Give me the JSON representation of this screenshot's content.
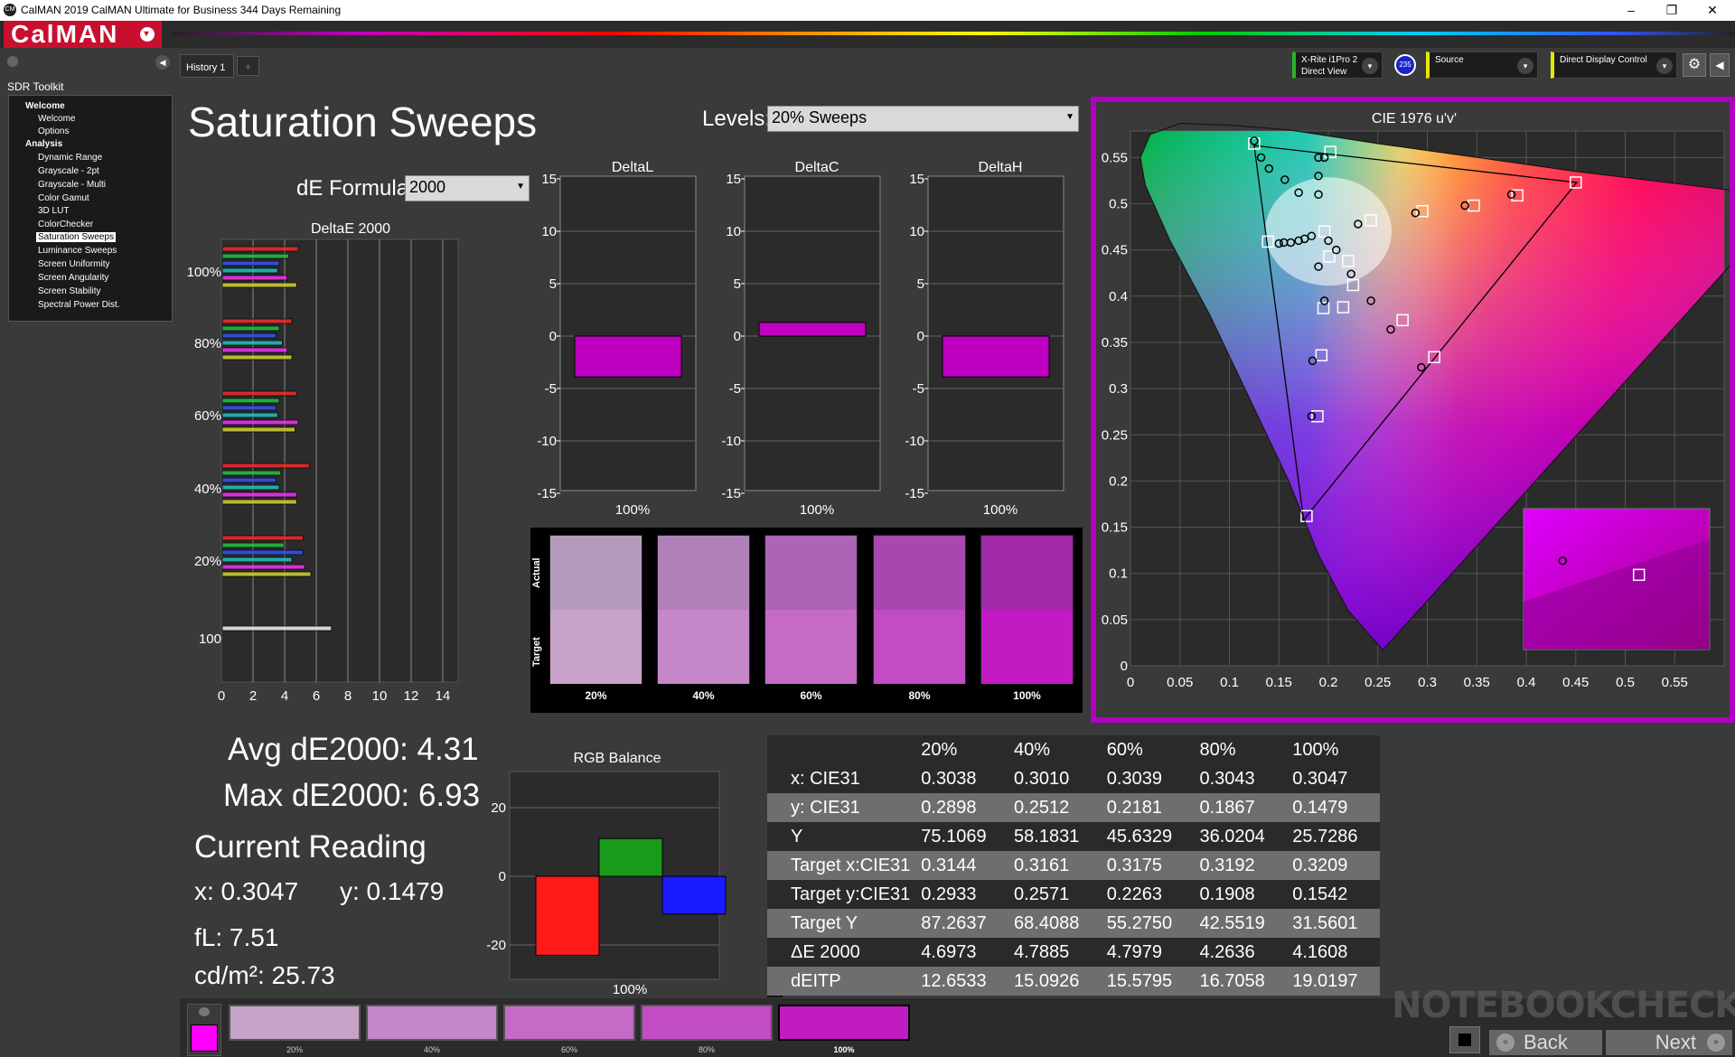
{
  "window": {
    "title": "CalMAN 2019 CalMAN Ultimate for Business 344 Days Remaining",
    "icon": "CM",
    "minimize": "–",
    "maximize": "❐",
    "close": "✕"
  },
  "logo": {
    "text": "CalMAN",
    "menu": "▾"
  },
  "sidebar": {
    "title": "SDR Toolkit",
    "items": [
      {
        "label": "Welcome"
      },
      {
        "label": "Welcome"
      },
      {
        "label": "Options"
      },
      {
        "label": "Analysis"
      },
      {
        "label": "Dynamic Range"
      },
      {
        "label": "Grayscale - 2pt"
      },
      {
        "label": "Grayscale - Multi"
      },
      {
        "label": "Color Gamut"
      },
      {
        "label": "3D LUT"
      },
      {
        "label": "ColorChecker"
      },
      {
        "label": "Saturation Sweeps"
      },
      {
        "label": "Luminance Sweeps"
      },
      {
        "label": "Screen Uniformity"
      },
      {
        "label": "Screen Angularity"
      },
      {
        "label": "Screen Stability"
      },
      {
        "label": "Spectral Power Dist."
      }
    ]
  },
  "tabs": {
    "history": "History 1",
    "add": "+"
  },
  "devices": {
    "meter": {
      "line1": "X-Rite i1Pro 2",
      "line2": "Direct View",
      "color": "#2bb02b",
      "badge": "235"
    },
    "source": {
      "label": "Source",
      "color": "#e6e600"
    },
    "display": {
      "label": "Direct Display Control",
      "color": "#e6e600"
    }
  },
  "page": {
    "title": "Saturation Sweeps",
    "levels_label": "Levels:",
    "levels_value": "20% Sweeps",
    "de_label": "dE Formula:",
    "de_value": "2000"
  },
  "deltaE_chart": {
    "title": "DeltaE 2000",
    "x_ticks": [
      "0",
      "2",
      "4",
      "6",
      "8",
      "10",
      "12",
      "14"
    ],
    "groups": [
      {
        "label": "100%",
        "values": [
          4.8,
          4.2,
          3.6,
          3.5,
          4.1,
          4.7
        ]
      },
      {
        "label": "80%",
        "values": [
          4.4,
          3.6,
          3.4,
          3.8,
          4.1,
          4.4
        ]
      },
      {
        "label": "60%",
        "values": [
          4.7,
          3.6,
          3.4,
          3.5,
          4.8,
          4.6
        ]
      },
      {
        "label": "40%",
        "values": [
          5.5,
          3.7,
          3.4,
          3.6,
          4.7,
          4.7
        ]
      },
      {
        "label": "20%",
        "values": [
          5.1,
          3.9,
          5.1,
          4.4,
          5.2,
          5.6
        ]
      },
      {
        "label": "100",
        "values": [
          6.9
        ]
      }
    ],
    "colors": [
      "#ff2a2a",
      "#22cc44",
      "#3355ff",
      "#22cccc",
      "#ff33ff",
      "#dddd33"
    ]
  },
  "delta_charts": [
    {
      "title": "DeltaL",
      "value": -3.9,
      "xlabel": "100%"
    },
    {
      "title": "DeltaC",
      "value": 1.3,
      "xlabel": "100%"
    },
    {
      "title": "DeltaH",
      "value": -3.9,
      "xlabel": "100%"
    }
  ],
  "delta_y_ticks": [
    "15",
    "10",
    "5",
    "0",
    "-5",
    "-10",
    "-15"
  ],
  "swatches": {
    "actual_label": "Actual",
    "target_label": "Target",
    "items": [
      {
        "label": "20%",
        "actual": "#b49bbc",
        "target": "#c6a2c8"
      },
      {
        "label": "40%",
        "actual": "#b081b8",
        "target": "#c587c8"
      },
      {
        "label": "60%",
        "actual": "#ac64b4",
        "target": "#c56ac7"
      },
      {
        "label": "80%",
        "actual": "#a748ae",
        "target": "#c24cc4"
      },
      {
        "label": "100%",
        "actual": "#a22aa8",
        "target": "#c21bc4"
      }
    ]
  },
  "cie": {
    "title": "CIE 1976 u'v'",
    "x_ticks": [
      "0",
      "0.05",
      "0.1",
      "0.15",
      "0.2",
      "0.25",
      "0.3",
      "0.35",
      "0.4",
      "0.45",
      "0.5",
      "0.55"
    ],
    "y_ticks": [
      "0",
      "0.05",
      "0.1",
      "0.15",
      "0.2",
      "0.25",
      "0.3",
      "0.35",
      "0.4",
      "0.45",
      "0.5",
      "0.55"
    ]
  },
  "chart_data": {
    "type": "scatter",
    "title": "CIE 1976 u'v'",
    "xlim": [
      0,
      0.6
    ],
    "ylim": [
      0,
      0.6
    ],
    "targets": [
      [
        0.125,
        0.565
      ],
      [
        0.202,
        0.556
      ],
      [
        0.45,
        0.523
      ],
      [
        0.391,
        0.509
      ],
      [
        0.347,
        0.498
      ],
      [
        0.295,
        0.492
      ],
      [
        0.243,
        0.482
      ],
      [
        0.196,
        0.47
      ],
      [
        0.139,
        0.459
      ],
      [
        0.22,
        0.438
      ],
      [
        0.201,
        0.443
      ],
      [
        0.225,
        0.412
      ],
      [
        0.215,
        0.388
      ],
      [
        0.195,
        0.387
      ],
      [
        0.275,
        0.374
      ],
      [
        0.193,
        0.336
      ],
      [
        0.307,
        0.334
      ],
      [
        0.189,
        0.27
      ],
      [
        0.178,
        0.162
      ]
    ],
    "measured": [
      [
        0.125,
        0.568
      ],
      [
        0.132,
        0.55
      ],
      [
        0.14,
        0.538
      ],
      [
        0.156,
        0.526
      ],
      [
        0.17,
        0.512
      ],
      [
        0.19,
        0.55
      ],
      [
        0.19,
        0.53
      ],
      [
        0.19,
        0.51
      ],
      [
        0.196,
        0.55
      ],
      [
        0.2,
        0.46
      ],
      [
        0.183,
        0.465
      ],
      [
        0.176,
        0.462
      ],
      [
        0.17,
        0.46
      ],
      [
        0.162,
        0.458
      ],
      [
        0.155,
        0.458
      ],
      [
        0.15,
        0.457
      ],
      [
        0.23,
        0.478
      ],
      [
        0.288,
        0.49
      ],
      [
        0.338,
        0.498
      ],
      [
        0.385,
        0.51
      ],
      [
        0.208,
        0.45
      ],
      [
        0.19,
        0.432
      ],
      [
        0.223,
        0.424
      ],
      [
        0.196,
        0.395
      ],
      [
        0.243,
        0.395
      ],
      [
        0.263,
        0.364
      ],
      [
        0.184,
        0.33
      ],
      [
        0.294,
        0.323
      ],
      [
        0.183,
        0.27
      ]
    ],
    "inset": {
      "target": [
        0.62,
        0.47
      ],
      "measured": [
        0.21,
        0.37
      ]
    }
  },
  "summary": {
    "avg": "Avg dE2000: 4.31",
    "max": "Max dE2000: 6.93",
    "current": "Current Reading",
    "x": "x: 0.3047",
    "y": "y: 0.1479",
    "fl": "fL: 7.51",
    "cd": "cd/m²: 25.73"
  },
  "rgb_balance": {
    "title": "RGB Balance",
    "y_ticks": [
      "20",
      "0",
      "-20"
    ],
    "values": [
      {
        "name": "R",
        "v": -23,
        "color": "#ff1a1a"
      },
      {
        "name": "G",
        "v": 11,
        "color": "#1a9a1a"
      },
      {
        "name": "B",
        "v": -11,
        "color": "#1a1aff"
      }
    ],
    "xlabel": "100%"
  },
  "table": {
    "header": [
      "",
      "20%",
      "40%",
      "60%",
      "80%",
      "100%"
    ],
    "rows": [
      {
        "label": "x: CIE31",
        "values": [
          "0.3038",
          "0.3010",
          "0.3039",
          "0.3043",
          "0.3047"
        ]
      },
      {
        "label": "y: CIE31",
        "values": [
          "0.2898",
          "0.2512",
          "0.2181",
          "0.1867",
          "0.1479"
        ]
      },
      {
        "label": "Y",
        "values": [
          "75.1069",
          "58.1831",
          "45.6329",
          "36.0204",
          "25.7286"
        ]
      },
      {
        "label": "Target x:CIE31",
        "values": [
          "0.3144",
          "0.3161",
          "0.3175",
          "0.3192",
          "0.3209"
        ]
      },
      {
        "label": "Target y:CIE31",
        "values": [
          "0.2933",
          "0.2571",
          "0.2263",
          "0.1908",
          "0.1542"
        ]
      },
      {
        "label": "Target Y",
        "values": [
          "87.2637",
          "68.4088",
          "55.2750",
          "42.5519",
          "31.5601"
        ]
      },
      {
        "label": "ΔE 2000",
        "values": [
          "4.6973",
          "4.7885",
          "4.7979",
          "4.2636",
          "4.1608"
        ]
      },
      {
        "label": "dEITP",
        "values": [
          "12.6533",
          "15.0926",
          "15.5795",
          "16.7058",
          "19.0197"
        ]
      }
    ]
  },
  "bottom": {
    "current_color": "#ff00ff",
    "swatches": [
      {
        "label": "20%",
        "color": "#c6a2c8"
      },
      {
        "label": "40%",
        "color": "#c587c8"
      },
      {
        "label": "60%",
        "color": "#c56ac7"
      },
      {
        "label": "80%",
        "color": "#c24cc4"
      },
      {
        "label": "100%",
        "color": "#c21bc4"
      }
    ],
    "back": "Back",
    "next": "Next",
    "back_icon": "«",
    "next_icon": "»"
  },
  "watermark": "NOTEBOOKCHECK"
}
